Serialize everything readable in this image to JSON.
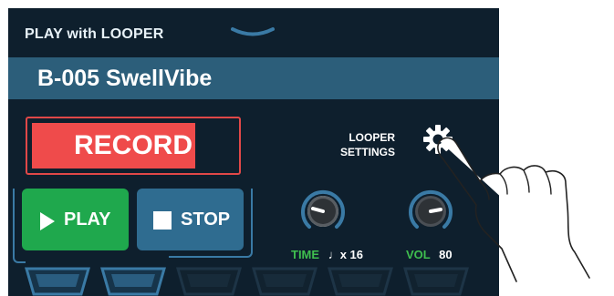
{
  "header": {
    "title": "PLAY with LOOPER"
  },
  "patch": {
    "name": "B-005 SwellVibe"
  },
  "record_button": {
    "label": "RECORD",
    "color": "#ef4b4b"
  },
  "looper_settings": {
    "line1": "LOOPER",
    "line2": "SETTINGS",
    "icon": "gear-icon"
  },
  "play_button": {
    "label": "PLAY",
    "icon": "play-icon",
    "color": "#1fa84d"
  },
  "stop_button": {
    "label": "STOP",
    "icon": "stop-icon",
    "color": "#2f6c90"
  },
  "knobs": [
    {
      "name": "TIME",
      "value": "x 16",
      "icon": "quarter-note-icon",
      "level": 0.3
    },
    {
      "name": "VOL",
      "value": "80",
      "level": 0.8
    }
  ],
  "footswitches": [
    {
      "id": 1,
      "active": true
    },
    {
      "id": 2,
      "active": true
    },
    {
      "id": 3,
      "active": false
    },
    {
      "id": 4,
      "active": false
    },
    {
      "id": 5,
      "active": false
    },
    {
      "id": 6,
      "active": false
    }
  ],
  "colors": {
    "screen_bg": "#0e1f2d",
    "patch_bar": "#2c5e7a",
    "accent_blue": "#3a7aa5",
    "knob_label_green": "#3fbf4f"
  }
}
